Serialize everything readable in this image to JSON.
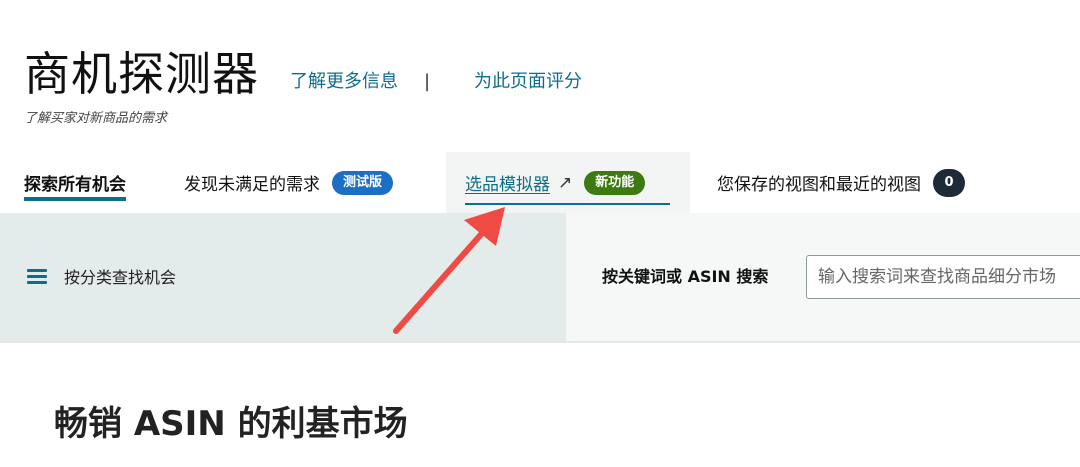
{
  "header": {
    "title": "商机探测器",
    "learn_more": "了解更多信息",
    "separator": "|",
    "rate_page": "为此页面评分",
    "subtitle": "了解买家对新商品的需求"
  },
  "tabs": {
    "explore": {
      "label": "探索所有机会"
    },
    "unmet": {
      "label": "发现未满足的需求",
      "badge": "测试版"
    },
    "simulator": {
      "label": "选品模拟器",
      "badge": "新功能"
    },
    "saved": {
      "label": "您保存的视图和最近的视图",
      "count": "0"
    }
  },
  "search": {
    "category_label": "按分类查找机会",
    "keyword_label": "按关键词或 ASIN 搜索",
    "placeholder": "输入搜索词来查找商品细分市场"
  },
  "section": {
    "title": "畅销 ASIN 的利基市场"
  },
  "colors": {
    "link": "#0f6d8c",
    "badge_beta": "#1d6fc4",
    "badge_new": "#3d7a10",
    "badge_count": "#1d2a38",
    "annotation_arrow": "#ef4a44"
  }
}
